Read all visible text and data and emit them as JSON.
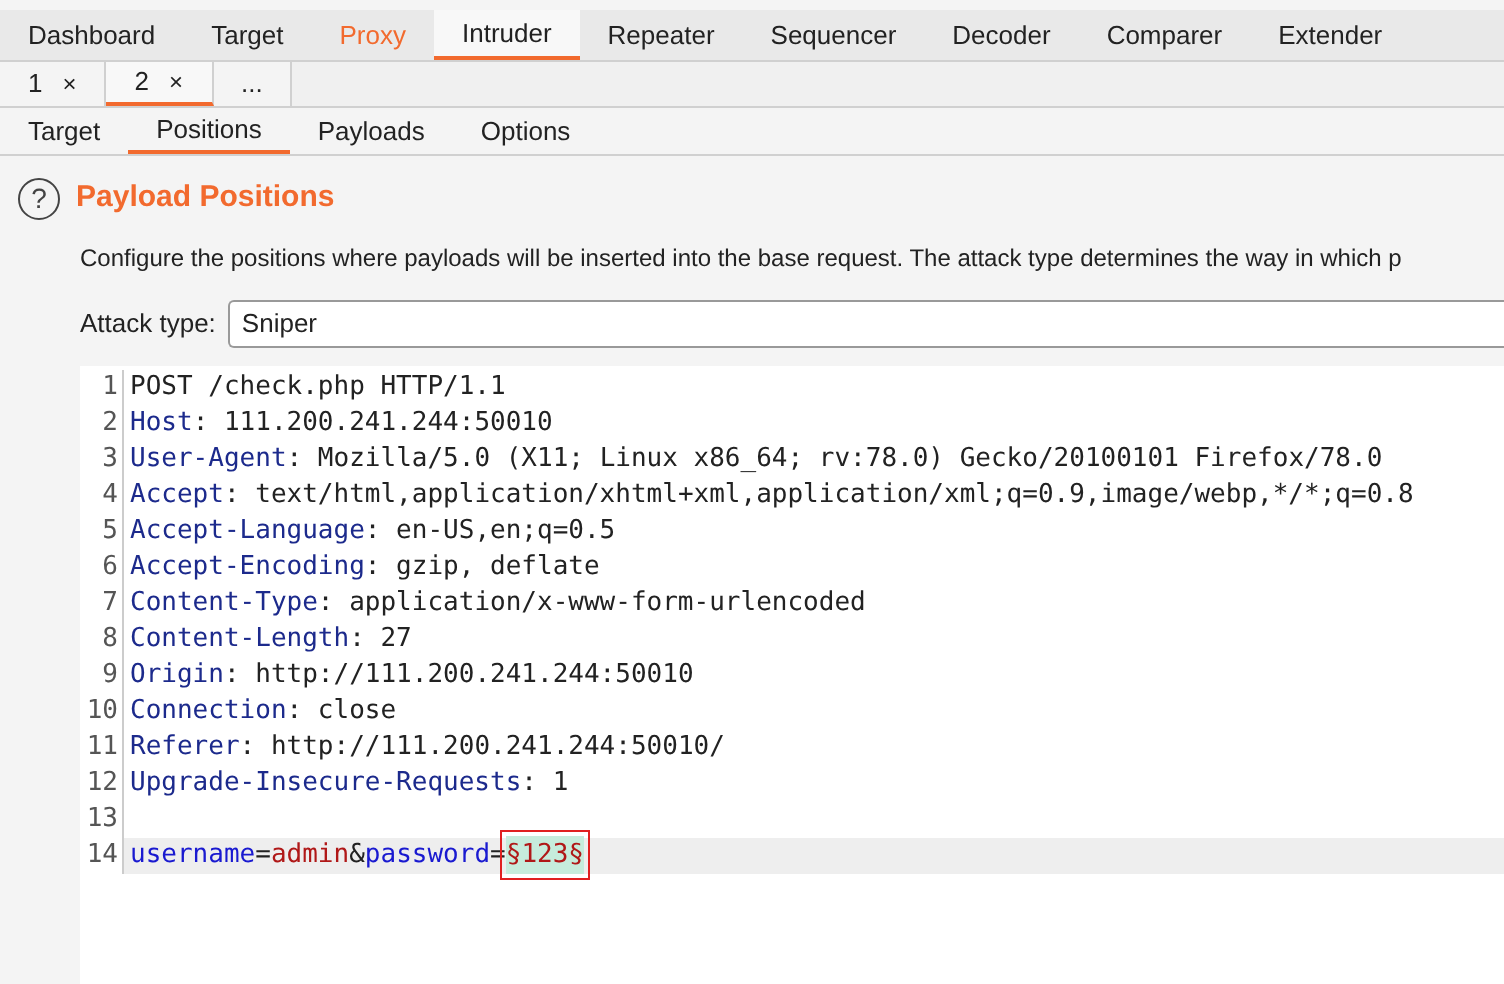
{
  "main_tabs": [
    {
      "label": "Dashboard",
      "selected": false,
      "highlighted": false
    },
    {
      "label": "Target",
      "selected": false,
      "highlighted": false
    },
    {
      "label": "Proxy",
      "selected": false,
      "highlighted": true
    },
    {
      "label": "Intruder",
      "selected": true,
      "highlighted": false
    },
    {
      "label": "Repeater",
      "selected": false,
      "highlighted": false
    },
    {
      "label": "Sequencer",
      "selected": false,
      "highlighted": false
    },
    {
      "label": "Decoder",
      "selected": false,
      "highlighted": false
    },
    {
      "label": "Comparer",
      "selected": false,
      "highlighted": false
    },
    {
      "label": "Extender",
      "selected": false,
      "highlighted": false
    }
  ],
  "attack_tabs": [
    {
      "label": "1",
      "close": "×",
      "selected": false
    },
    {
      "label": "2",
      "close": "×",
      "selected": true
    },
    {
      "label": "...",
      "selected": false
    }
  ],
  "sub_tabs": [
    {
      "label": "Target",
      "selected": false
    },
    {
      "label": "Positions",
      "selected": true
    },
    {
      "label": "Payloads",
      "selected": false
    },
    {
      "label": "Options",
      "selected": false
    }
  ],
  "section": {
    "help": "?",
    "title": "Payload Positions",
    "description": "Configure the positions where payloads will be inserted into the base request. The attack type determines the way in which p"
  },
  "attack_type": {
    "label": "Attack type:",
    "value": "Sniper"
  },
  "editor": {
    "lines": [
      {
        "number": "1",
        "current": false,
        "segments": [
          {
            "kind": "plain",
            "text": "POST /check.php HTTP/1.1"
          }
        ]
      },
      {
        "number": "2",
        "current": false,
        "segments": [
          {
            "kind": "header",
            "text": "Host"
          },
          {
            "kind": "plain",
            "text": ": 111.200.241.244:50010"
          }
        ]
      },
      {
        "number": "3",
        "current": false,
        "segments": [
          {
            "kind": "header",
            "text": "User-Agent"
          },
          {
            "kind": "plain",
            "text": ": Mozilla/5.0 (X11; Linux x86_64; rv:78.0) Gecko/20100101 Firefox/78.0"
          }
        ]
      },
      {
        "number": "4",
        "current": false,
        "segments": [
          {
            "kind": "header",
            "text": "Accept"
          },
          {
            "kind": "plain",
            "text": ": text/html,application/xhtml+xml,application/xml;q=0.9,image/webp,*/*;q=0.8"
          }
        ]
      },
      {
        "number": "5",
        "current": false,
        "segments": [
          {
            "kind": "header",
            "text": "Accept-Language"
          },
          {
            "kind": "plain",
            "text": ": en-US,en;q=0.5"
          }
        ]
      },
      {
        "number": "6",
        "current": false,
        "segments": [
          {
            "kind": "header",
            "text": "Accept-Encoding"
          },
          {
            "kind": "plain",
            "text": ": gzip, deflate"
          }
        ]
      },
      {
        "number": "7",
        "current": false,
        "segments": [
          {
            "kind": "header",
            "text": "Content-Type"
          },
          {
            "kind": "plain",
            "text": ": application/x-www-form-urlencoded"
          }
        ]
      },
      {
        "number": "8",
        "current": false,
        "segments": [
          {
            "kind": "header",
            "text": "Content-Length"
          },
          {
            "kind": "plain",
            "text": ": 27"
          }
        ]
      },
      {
        "number": "9",
        "current": false,
        "segments": [
          {
            "kind": "header",
            "text": "Origin"
          },
          {
            "kind": "plain",
            "text": ": http://111.200.241.244:50010"
          }
        ]
      },
      {
        "number": "10",
        "current": false,
        "segments": [
          {
            "kind": "header",
            "text": "Connection"
          },
          {
            "kind": "plain",
            "text": ": close"
          }
        ]
      },
      {
        "number": "11",
        "current": false,
        "segments": [
          {
            "kind": "header",
            "text": "Referer"
          },
          {
            "kind": "plain",
            "text": ": http://111.200.241.244:50010/"
          }
        ]
      },
      {
        "number": "12",
        "current": false,
        "segments": [
          {
            "kind": "header",
            "text": "Upgrade-Insecure-Requests"
          },
          {
            "kind": "plain",
            "text": ": 1"
          }
        ]
      },
      {
        "number": "13",
        "current": false
      },
      {
        "number": "14",
        "current": true,
        "segments": [
          {
            "kind": "param",
            "text": "username"
          },
          {
            "kind": "plain",
            "text": "="
          },
          {
            "kind": "value",
            "text": "admin"
          },
          {
            "kind": "plain",
            "text": "&"
          },
          {
            "kind": "param",
            "text": "password"
          },
          {
            "kind": "plain",
            "text": "="
          },
          {
            "kind": "payload",
            "text": "§123§",
            "boxed": true
          }
        ]
      }
    ]
  }
}
